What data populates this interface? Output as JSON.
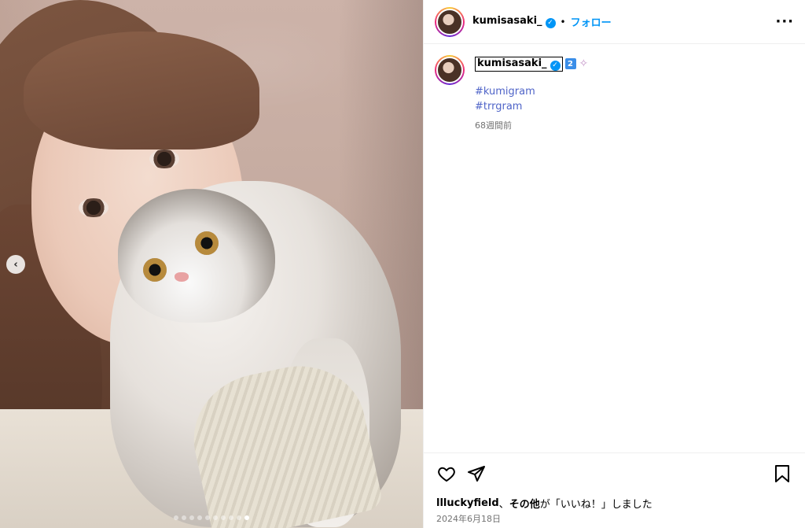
{
  "header": {
    "username": "kumisasaki_",
    "separator": "•",
    "follow_label": "フォロー",
    "more_icon": "more-horizontal-icon"
  },
  "caption": {
    "username": "kumisasaki_",
    "badge_text": "2",
    "hashtags": [
      "#kumigram",
      "#trrgram"
    ],
    "time_ago": "68週間前"
  },
  "carousel": {
    "prev_icon": "chevron-left-icon",
    "total_slides": 10,
    "active_slide": 10
  },
  "actions": {
    "like_icon": "heart-icon",
    "share_icon": "paper-plane-icon",
    "save_icon": "bookmark-icon"
  },
  "likes": {
    "liker": "llluckyfield",
    "comma": "、",
    "others": "その他",
    "suffix": "が「いいね！」しました"
  },
  "post_date": "2024年6月18日",
  "colors": {
    "accent": "#0095f6",
    "hashtag": "#4f64c8",
    "muted": "#737373"
  }
}
